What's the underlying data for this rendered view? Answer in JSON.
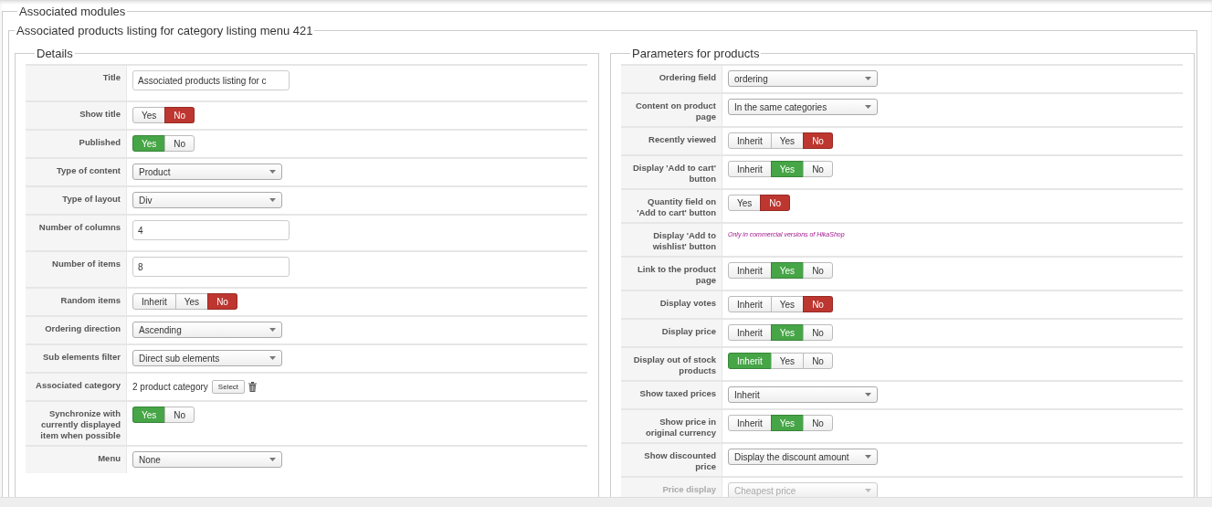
{
  "module_group": {
    "legend": "Associated modules",
    "module": {
      "legend": "Associated products listing for category listing menu 421",
      "panels": [
        {
          "legend": "Details",
          "rows": [
            {
              "label": "Title",
              "kind": "input",
              "value": "Associated products listing for c"
            },
            {
              "label": "Show title",
              "kind": "toggle",
              "options": [
                {
                  "label": "Yes",
                  "selected": false
                },
                {
                  "label": "No",
                  "selected": true,
                  "color": "#bd362f"
                }
              ]
            },
            {
              "label": "Published",
              "kind": "toggle",
              "options": [
                {
                  "label": "Yes",
                  "selected": true,
                  "color": "#46a546"
                },
                {
                  "label": "No",
                  "selected": false
                }
              ]
            },
            {
              "label": "Type of content",
              "kind": "select",
              "value": "Product"
            },
            {
              "label": "Type of layout",
              "kind": "select",
              "value": "Div"
            },
            {
              "label": "Number of columns",
              "kind": "input",
              "value": "4"
            },
            {
              "label": "Number of items",
              "kind": "input",
              "value": "8"
            },
            {
              "label": "Random items",
              "kind": "toggle",
              "options": [
                {
                  "label": "Inherit",
                  "selected": false
                },
                {
                  "label": "Yes",
                  "selected": false
                },
                {
                  "label": "No",
                  "selected": true,
                  "color": "#bd362f"
                }
              ]
            },
            {
              "label": "Ordering direction",
              "kind": "select",
              "value": "Ascending"
            },
            {
              "label": "Sub elements filter",
              "kind": "select",
              "value": "Direct sub elements"
            },
            {
              "label": "Associated category",
              "kind": "category",
              "value": "2 product category",
              "button": "Select"
            },
            {
              "label": "Synchronize with currently displayed item when possible",
              "kind": "toggle",
              "options": [
                {
                  "label": "Yes",
                  "selected": true,
                  "color": "#46a546"
                },
                {
                  "label": "No",
                  "selected": false
                }
              ]
            },
            {
              "label": "Menu",
              "kind": "select",
              "value": "None"
            }
          ]
        },
        {
          "legend": "Parameters for products",
          "rows": [
            {
              "label": "Ordering field",
              "kind": "select",
              "value": "ordering"
            },
            {
              "label": "Content on product page",
              "kind": "select",
              "value": "In the same categories"
            },
            {
              "label": "Recently viewed",
              "kind": "toggle",
              "options": [
                {
                  "label": "Inherit",
                  "selected": false
                },
                {
                  "label": "Yes",
                  "selected": false
                },
                {
                  "label": "No",
                  "selected": true,
                  "color": "#bd362f"
                }
              ]
            },
            {
              "label": "Display 'Add to cart' button",
              "kind": "toggle",
              "options": [
                {
                  "label": "Inherit",
                  "selected": false
                },
                {
                  "label": "Yes",
                  "selected": true,
                  "color": "#46a546"
                },
                {
                  "label": "No",
                  "selected": false
                }
              ]
            },
            {
              "label": "Quantity field on 'Add to cart' button",
              "kind": "toggle",
              "options": [
                {
                  "label": "Yes",
                  "selected": false
                },
                {
                  "label": "No",
                  "selected": true,
                  "color": "#bd362f"
                }
              ]
            },
            {
              "label": "Display 'Add to wishlist' button",
              "kind": "note",
              "value": "Only in commercial versions of HikaShop"
            },
            {
              "label": "Link to the product page",
              "kind": "toggle",
              "options": [
                {
                  "label": "Inherit",
                  "selected": false
                },
                {
                  "label": "Yes",
                  "selected": true,
                  "color": "#46a546"
                },
                {
                  "label": "No",
                  "selected": false
                }
              ]
            },
            {
              "label": "Display votes",
              "kind": "toggle",
              "options": [
                {
                  "label": "Inherit",
                  "selected": false
                },
                {
                  "label": "Yes",
                  "selected": false
                },
                {
                  "label": "No",
                  "selected": true,
                  "color": "#bd362f"
                }
              ]
            },
            {
              "label": "Display price",
              "kind": "toggle",
              "options": [
                {
                  "label": "Inherit",
                  "selected": false
                },
                {
                  "label": "Yes",
                  "selected": true,
                  "color": "#46a546"
                },
                {
                  "label": "No",
                  "selected": false
                }
              ]
            },
            {
              "label": "Display out of stock products",
              "kind": "toggle",
              "options": [
                {
                  "label": "Inherit",
                  "selected": true,
                  "color": "#46a546"
                },
                {
                  "label": "Yes",
                  "selected": false
                },
                {
                  "label": "No",
                  "selected": false
                }
              ]
            },
            {
              "label": "Show taxed prices",
              "kind": "select",
              "value": "Inherit"
            },
            {
              "label": "Show price in original currency",
              "kind": "toggle",
              "options": [
                {
                  "label": "Inherit",
                  "selected": false
                },
                {
                  "label": "Yes",
                  "selected": true,
                  "color": "#46a546"
                },
                {
                  "label": "No",
                  "selected": false
                }
              ]
            },
            {
              "label": "Show discounted price",
              "kind": "select",
              "value": "Display the discount amount"
            },
            {
              "label": "Price display",
              "kind": "select",
              "value": "Cheapest price",
              "disabled": true
            }
          ]
        }
      ]
    }
  }
}
